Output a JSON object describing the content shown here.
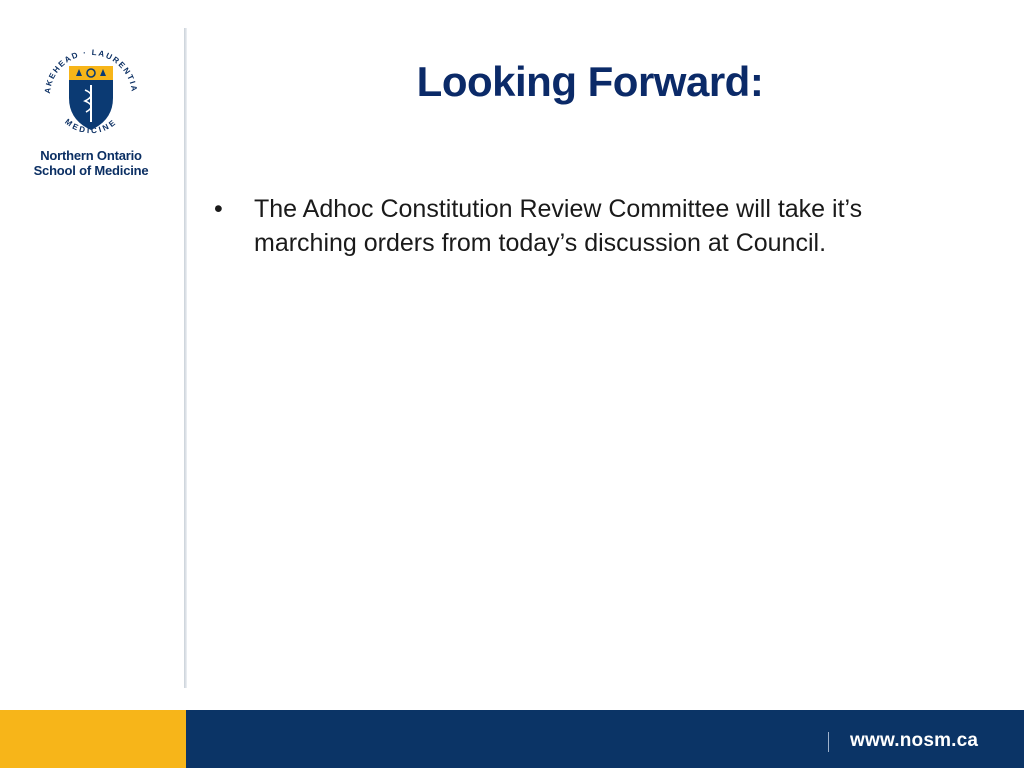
{
  "sidebar": {
    "seal": {
      "arc_text_top": "LAKEHEAD · LAURENTIAN",
      "arc_text_bottom": "MEDICINE"
    },
    "school_name_line1": "Northern Ontario",
    "school_name_line2": "School of Medicine"
  },
  "slide": {
    "title": "Looking Forward:",
    "bullets": [
      {
        "marker": "•",
        "line1": "The Adhoc Constitution Review Committee will take it’s",
        "line2": "marching orders from today’s discussion at Council."
      }
    ]
  },
  "footer": {
    "url": "www.nosm.ca"
  },
  "colors": {
    "navy": "#0b2a68",
    "footer_blue": "#0b3466",
    "gold": "#f7b519",
    "text": "#1a1a1a"
  }
}
